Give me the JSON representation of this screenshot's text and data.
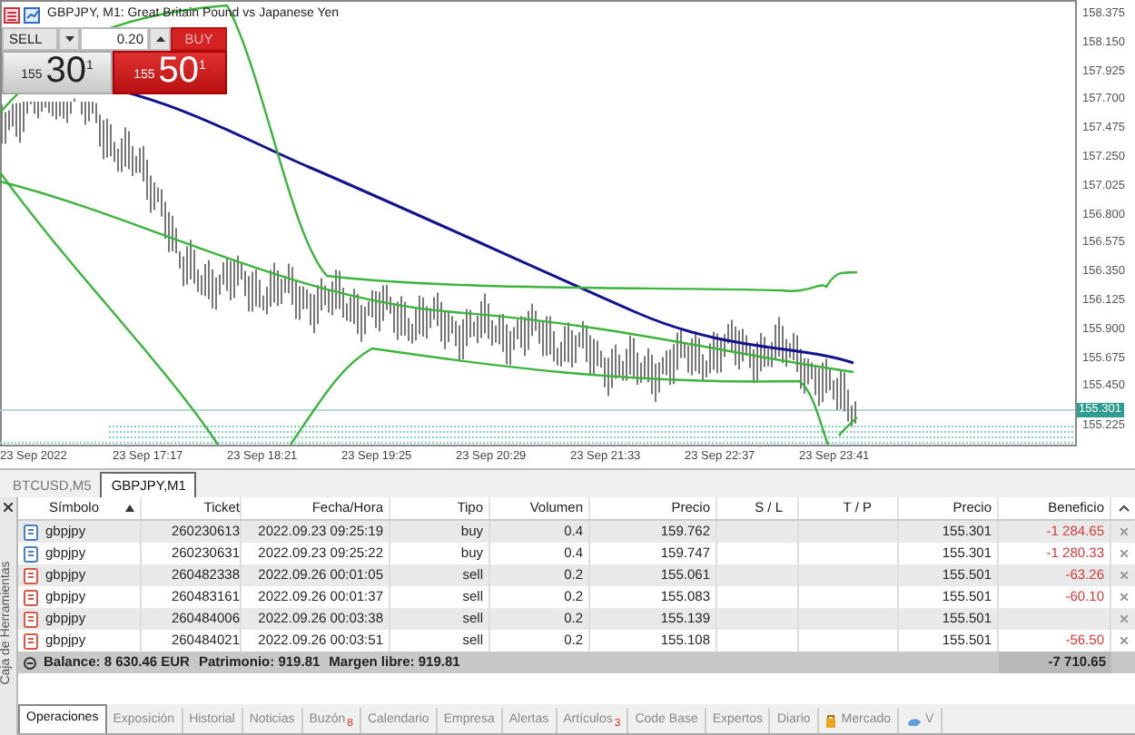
{
  "chart": {
    "title": "GBPJPY, M1:  Great Britain Pound vs Japanese Yen",
    "trade_panel": {
      "sell_label": "SELL",
      "lot": "0.20",
      "buy_label": "BUY",
      "sell_price": {
        "prefix": "155",
        "big": "30",
        "sup": "1"
      },
      "buy_price": {
        "prefix": "155",
        "big": "50",
        "sup": "1"
      }
    },
    "price_axis": [
      "158.375",
      "158.150",
      "157.925",
      "157.700",
      "157.475",
      "157.250",
      "157.025",
      "156.800",
      "156.575",
      "156.350",
      "156.125",
      "155.900",
      "155.675",
      "155.450",
      "155.225"
    ],
    "current_price": "155.301",
    "time_axis": [
      "23 Sep 2022",
      "23 Sep 17:17",
      "23 Sep 18:21",
      "23 Sep 19:25",
      "23 Sep 20:29",
      "23 Sep 21:33",
      "23 Sep 22:37",
      "23 Sep 23:41"
    ]
  },
  "chart_tabs": [
    {
      "label": "BTCUSD,M5",
      "selected": false
    },
    {
      "label": "GBPJPY,M1",
      "selected": true
    }
  ],
  "toolbox_title": "Caja de Herramientas",
  "table": {
    "columns": [
      {
        "label": "Símbolo",
        "sorted": true
      },
      {
        "label": "Ticket",
        "sorted": false
      },
      {
        "label": "Fecha/Hora",
        "sorted": false
      },
      {
        "label": "Tipo",
        "sorted": false
      },
      {
        "label": "Volumen",
        "sorted": false
      },
      {
        "label": "Precio",
        "sorted": false
      },
      {
        "label": "S / L",
        "sorted": false
      },
      {
        "label": "T / P",
        "sorted": false
      },
      {
        "label": "Precio",
        "sorted": false
      },
      {
        "label": "Beneficio",
        "sorted": false
      }
    ],
    "rows": [
      {
        "kind": "buy",
        "cells": [
          "gbpjpy",
          "260230613",
          "2022.09.23 09:25:19",
          "buy",
          "0.4",
          "159.762",
          "",
          "",
          "155.301",
          "-1 284.65"
        ]
      },
      {
        "kind": "buy",
        "cells": [
          "gbpjpy",
          "260230631",
          "2022.09.23 09:25:22",
          "buy",
          "0.4",
          "159.747",
          "",
          "",
          "155.301",
          "-1 280.33"
        ]
      },
      {
        "kind": "sell",
        "cells": [
          "gbpjpy",
          "260482338",
          "2022.09.26 00:01:05",
          "sell",
          "0.2",
          "155.061",
          "",
          "",
          "155.501",
          "-63.26"
        ]
      },
      {
        "kind": "sell",
        "cells": [
          "gbpjpy",
          "260483161",
          "2022.09.26 00:01:37",
          "sell",
          "0.2",
          "155.083",
          "",
          "",
          "155.501",
          "-60.10"
        ]
      },
      {
        "kind": "sell",
        "cells": [
          "gbpjpy",
          "260484006",
          "2022.09.26 00:03:38",
          "sell",
          "0.2",
          "155.139",
          "",
          "",
          "155.501",
          ""
        ]
      },
      {
        "kind": "sell",
        "cells": [
          "gbpjpy",
          "260484021",
          "2022.09.26 00:03:51",
          "sell",
          "0.2",
          "155.108",
          "",
          "",
          "155.501",
          "-56.50"
        ]
      }
    ]
  },
  "summary": {
    "balance": "Balance: 8 630.46 EUR",
    "equity": "Patrimonio: 919.81",
    "free_margin": "Margen libre: 919.81",
    "total": "-7 710.65"
  },
  "bottom_tabs": [
    {
      "label": "Operaciones",
      "selected": true
    },
    {
      "label": "Exposición",
      "selected": false
    },
    {
      "label": "Historial",
      "selected": false
    },
    {
      "label": "Noticias",
      "selected": false
    },
    {
      "label": "Buzón",
      "badge": "8",
      "selected": false
    },
    {
      "label": "Calendario",
      "selected": false
    },
    {
      "label": "Empresa",
      "selected": false
    },
    {
      "label": "Alertas",
      "selected": false
    },
    {
      "label": "Artículos",
      "badge": "3",
      "selected": false
    },
    {
      "label": "Code Base",
      "selected": false
    },
    {
      "label": "Expertos",
      "selected": false
    },
    {
      "label": "Diario",
      "selected": false
    },
    {
      "label": "Mercado",
      "kind": "market",
      "selected": false
    },
    {
      "label": "V",
      "kind": "vps",
      "selected": false
    }
  ]
}
